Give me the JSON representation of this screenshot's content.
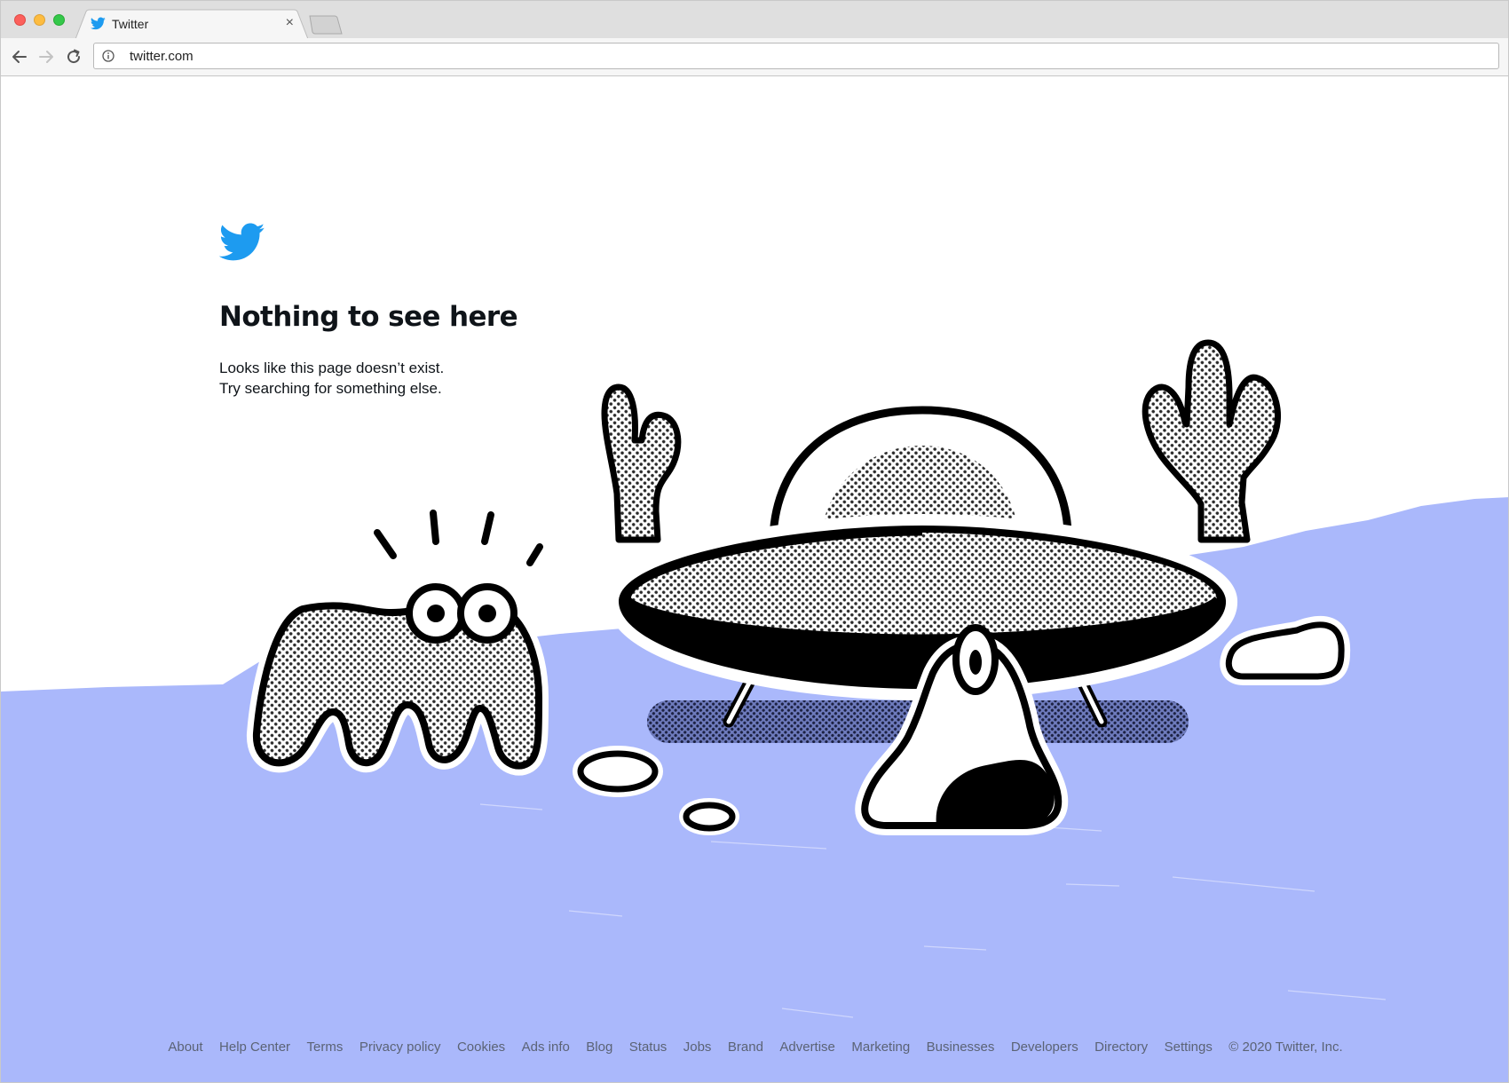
{
  "browser": {
    "tab_title": "Twitter",
    "tab_close": "×",
    "url": "twitter.com",
    "icons": [
      "twitter-bird-icon",
      "close-icon",
      "back-arrow-icon",
      "forward-arrow-icon",
      "reload-icon",
      "info-icon"
    ]
  },
  "page": {
    "heading": "Nothing to see here",
    "body_lines": [
      "Looks like this page doesn’t exist.",
      "Try searching for something else."
    ],
    "brand_color": "#1d9bf0",
    "ground_color": "#aab8fb"
  },
  "footer": {
    "links": [
      "About",
      "Help Center",
      "Terms",
      "Privacy policy",
      "Cookies",
      "Ads info",
      "Blog",
      "Status",
      "Jobs",
      "Brand",
      "Advertise",
      "Marketing",
      "Businesses",
      "Developers",
      "Directory",
      "Settings"
    ],
    "copyright": "© 2020 Twitter, Inc."
  }
}
